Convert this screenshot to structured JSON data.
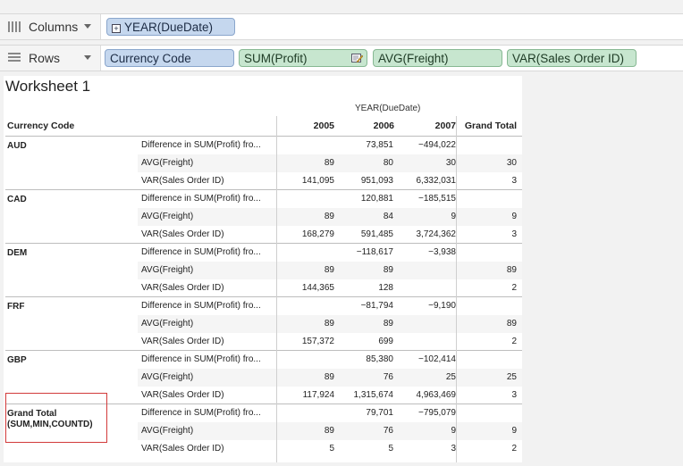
{
  "shelves": {
    "columns": {
      "label": "Columns",
      "pills": [
        {
          "text": "YEAR(DueDate)",
          "color": "blue",
          "expand": "+"
        }
      ]
    },
    "rows": {
      "label": "Rows",
      "pills": [
        {
          "text": "Currency Code",
          "color": "blue"
        },
        {
          "text": "SUM(Profit)",
          "color": "green",
          "has_edit_icon": true
        },
        {
          "text": "AVG(Freight)",
          "color": "green"
        },
        {
          "text": "VAR(Sales Order ID)",
          "color": "green"
        }
      ]
    }
  },
  "worksheet": {
    "title": "Worksheet 1",
    "column_group_label": "YEAR(DueDate)",
    "row_header": "Currency Code",
    "years": [
      "2005",
      "2006",
      "2007"
    ],
    "grand_total_label": "Grand Total",
    "groups": [
      {
        "name": "AUD",
        "rows": [
          {
            "measure": "Difference in SUM(Profit) fro...",
            "values": [
              "",
              "73,851",
              "−494,022"
            ],
            "total": ""
          },
          {
            "measure": "AVG(Freight)",
            "values": [
              "89",
              "80",
              "30"
            ],
            "total": "30"
          },
          {
            "measure": "VAR(Sales Order ID)",
            "values": [
              "141,095",
              "951,093",
              "6,332,031"
            ],
            "total": "3"
          }
        ]
      },
      {
        "name": "CAD",
        "rows": [
          {
            "measure": "Difference in SUM(Profit) fro...",
            "values": [
              "",
              "120,881",
              "−185,515"
            ],
            "total": ""
          },
          {
            "measure": "AVG(Freight)",
            "values": [
              "89",
              "84",
              "9"
            ],
            "total": "9"
          },
          {
            "measure": "VAR(Sales Order ID)",
            "values": [
              "168,279",
              "591,485",
              "3,724,362"
            ],
            "total": "3"
          }
        ]
      },
      {
        "name": "DEM",
        "rows": [
          {
            "measure": "Difference in SUM(Profit) fro...",
            "values": [
              "",
              "−118,617",
              "−3,938"
            ],
            "total": ""
          },
          {
            "measure": "AVG(Freight)",
            "values": [
              "89",
              "89",
              ""
            ],
            "total": "89"
          },
          {
            "measure": "VAR(Sales Order ID)",
            "values": [
              "144,365",
              "128",
              ""
            ],
            "total": "2"
          }
        ]
      },
      {
        "name": "FRF",
        "rows": [
          {
            "measure": "Difference in SUM(Profit) fro...",
            "values": [
              "",
              "−81,794",
              "−9,190"
            ],
            "total": ""
          },
          {
            "measure": "AVG(Freight)",
            "values": [
              "89",
              "89",
              ""
            ],
            "total": "89"
          },
          {
            "measure": "VAR(Sales Order ID)",
            "values": [
              "157,372",
              "699",
              ""
            ],
            "total": "2"
          }
        ]
      },
      {
        "name": "GBP",
        "rows": [
          {
            "measure": "Difference in SUM(Profit) fro...",
            "values": [
              "",
              "85,380",
              "−102,414"
            ],
            "total": ""
          },
          {
            "measure": "AVG(Freight)",
            "values": [
              "89",
              "76",
              "25"
            ],
            "total": "25"
          },
          {
            "measure": "VAR(Sales Order ID)",
            "values": [
              "117,924",
              "1,315,674",
              "4,963,469"
            ],
            "total": "3"
          }
        ]
      },
      {
        "name": "Grand Total\n(SUM,MIN,COUNTD)",
        "rows": [
          {
            "measure": "Difference in SUM(Profit) fro...",
            "values": [
              "",
              "79,701",
              "−795,079"
            ],
            "total": ""
          },
          {
            "measure": "AVG(Freight)",
            "values": [
              "89",
              "76",
              "9"
            ],
            "total": "9"
          },
          {
            "measure": "VAR(Sales Order ID)",
            "values": [
              "5",
              "5",
              "3"
            ],
            "total": "2"
          }
        ]
      }
    ]
  },
  "colors": {
    "blue_pill": "#c5d7ee",
    "green_pill": "#c7e6cf",
    "highlight": "#d23a3a"
  }
}
